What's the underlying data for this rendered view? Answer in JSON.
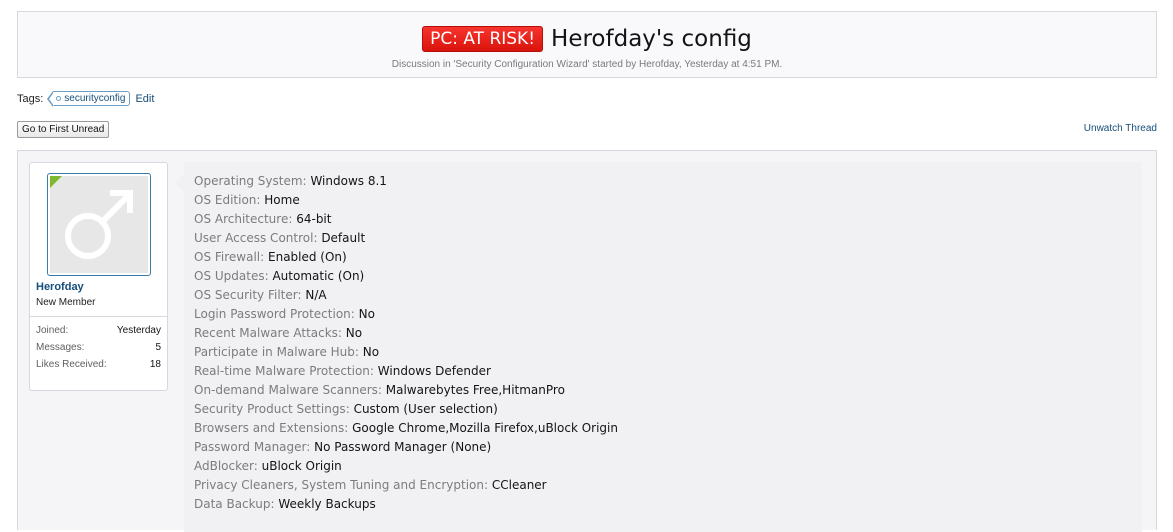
{
  "thread": {
    "prefix": "PC: AT RISK!",
    "title": "Herofday's config",
    "byline": "Discussion in 'Security Configuration Wizard' started by Herofday, Yesterday at 4:51 PM.",
    "colors": {
      "prefix_bg": "#e8231c",
      "link": "#174e7a",
      "avatar_corner": "#7cb92e"
    }
  },
  "tags": {
    "label": "Tags:",
    "items": [
      "securityconfig"
    ],
    "edit_label": "Edit"
  },
  "toolbar": {
    "first_unread_label": "Go to First Unread",
    "unwatch_label": "Unwatch Thread"
  },
  "user": {
    "avatar_icon": "male-symbol-icon",
    "name": "Herofday",
    "title": "New Member",
    "stats": [
      {
        "label": "Joined:",
        "value": "Yesterday"
      },
      {
        "label": "Messages:",
        "value": "5"
      },
      {
        "label": "Likes Received:",
        "value": "18"
      }
    ]
  },
  "config": [
    {
      "label": "Operating System:",
      "value": "Windows 8.1"
    },
    {
      "label": "OS Edition:",
      "value": "Home"
    },
    {
      "label": "OS Architecture:",
      "value": "64-bit"
    },
    {
      "label": "User Access Control:",
      "value": "Default"
    },
    {
      "label": "OS Firewall:",
      "value": "Enabled (On)"
    },
    {
      "label": "OS Updates:",
      "value": "Automatic (On)"
    },
    {
      "label": "OS Security Filter:",
      "value": "N/A"
    },
    {
      "label": "Login Password Protection:",
      "value": "No"
    },
    {
      "label": "Recent Malware Attacks:",
      "value": "No"
    },
    {
      "label": "Participate in Malware Hub:",
      "value": "No"
    },
    {
      "label": "Real-time Malware Protection:",
      "value": "Windows Defender"
    },
    {
      "label": "On-demand Malware Scanners:",
      "value": "Malwarebytes Free,HitmanPro"
    },
    {
      "label": "Security Product Settings:",
      "value": "Custom (User selection)"
    },
    {
      "label": "Browsers and Extensions:",
      "value": "Google Chrome,Mozilla Firefox,uBlock Origin"
    },
    {
      "label": "Password Manager:",
      "value": "No Password Manager (None)"
    },
    {
      "label": "AdBlocker:",
      "value": "uBlock Origin"
    },
    {
      "label": "Privacy Cleaners, System Tuning and Encryption:",
      "value": "CCleaner"
    },
    {
      "label": "Data Backup:",
      "value": "Weekly Backups"
    }
  ]
}
